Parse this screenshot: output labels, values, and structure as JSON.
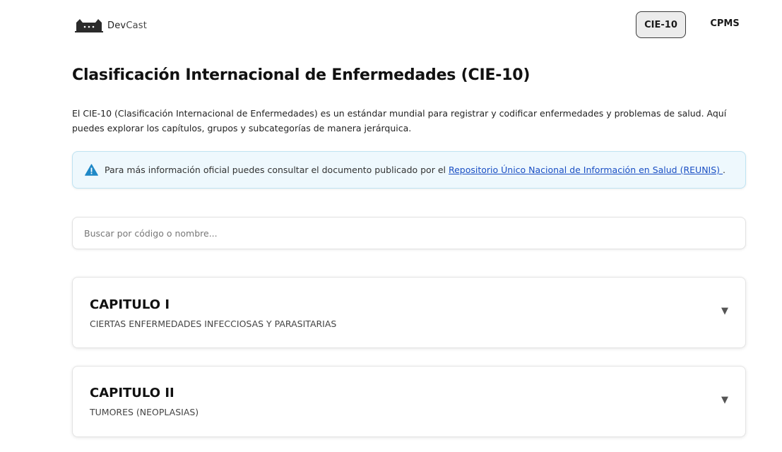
{
  "brand": {
    "name_part1": "Dev",
    "name_part2": "Cast",
    "logo_icon": "cat-icon"
  },
  "nav": [
    {
      "label": "CIE-10",
      "active": true
    },
    {
      "label": "CPMS",
      "active": false
    }
  ],
  "page": {
    "title": "Clasificación Internacional de Enfermedades (CIE-10)",
    "intro_line1": "El CIE-10 (Clasificación Internacional de Enfermedades) es un estándar mundial para registrar y codificar enfermedades y problemas de salud. Aquí",
    "intro_line2": "puedes explorar los capítulos, grupos y subcategorías de manera jerárquica."
  },
  "info": {
    "icon": "warning-icon",
    "text": "Para más información oficial puedes consultar el documento publicado por el ",
    "link_text": "Repositorio Único Nacional de Información en Salud (REUNIS) ",
    "suffix": "."
  },
  "search": {
    "placeholder": "Buscar por código o nombre...",
    "value": ""
  },
  "chapters": [
    {
      "title": "CAPITULO I",
      "subtitle": "CIERTAS ENFERMEDADES INFECCIOSAS Y PARASITARIAS",
      "chevron": "▼"
    },
    {
      "title": "CAPITULO II",
      "subtitle": "TUMORES (NEOPLASIAS)",
      "chevron": "▼"
    }
  ],
  "colors": {
    "accent_link": "#1a4fc4",
    "info_bg": "#eef8fd",
    "info_icon": "#1e88c7"
  }
}
